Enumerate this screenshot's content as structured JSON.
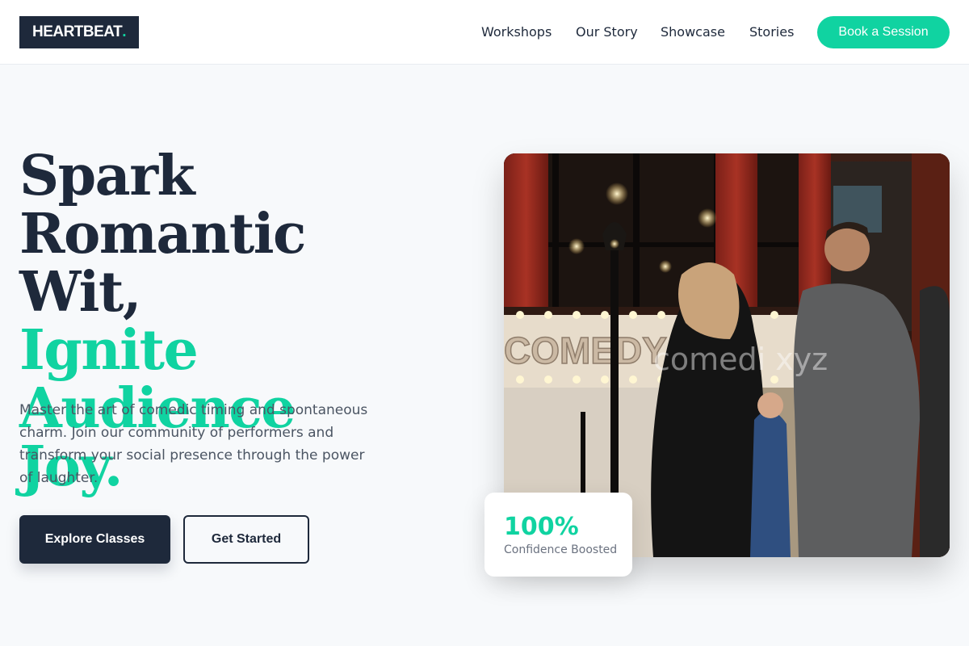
{
  "header": {
    "logo_text": "HEARTBEAT",
    "logo_dot": ".",
    "nav": [
      {
        "label": "Workshops"
      },
      {
        "label": "Our Story"
      },
      {
        "label": "Showcase"
      },
      {
        "label": "Stories"
      }
    ],
    "cta_label": "Book a Session"
  },
  "hero": {
    "headline_line1": "Spark Romantic",
    "headline_line2": "Wit,",
    "headline_accent1": "Ignite Audience",
    "headline_accent2": "Joy.",
    "lede": "Master the art of comedic timing and spontaneous charm. Join our community of performers and transform your social presence through the power of laughter.",
    "primary_button": "Explore Classes",
    "secondary_button": "Get Started",
    "image": {
      "sign_text": "COMEDY BAR",
      "watermark": "comedi xyz"
    },
    "stat": {
      "value": "100%",
      "label": "Confidence Boosted"
    }
  },
  "colors": {
    "accent": "#10d3a1",
    "dark": "#1e293b",
    "background": "#f7f9fb"
  }
}
